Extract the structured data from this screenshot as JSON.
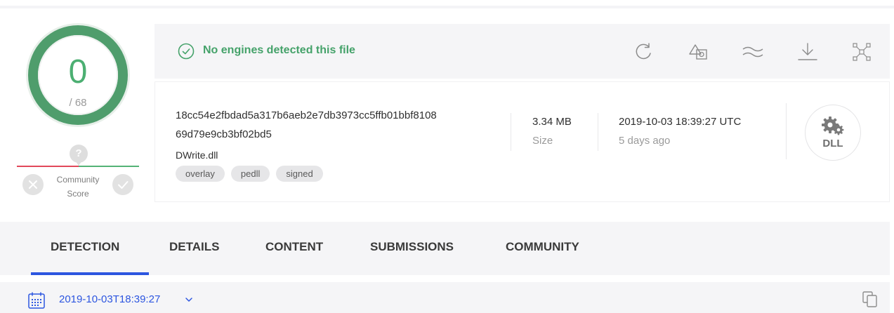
{
  "score": {
    "detections": "0",
    "total": "/ 68",
    "ring_color": "#4f9d6c"
  },
  "community": {
    "label_line1": "Community",
    "label_line2": "Score",
    "marker": "?",
    "down_icon": "close-icon",
    "up_icon": "check-icon"
  },
  "header": {
    "status_text": "No engines detected this file",
    "status_color": "#45a26a",
    "actions": [
      "reanalyze-icon",
      "similar-icon",
      "graph-icon",
      "download-icon",
      "fullscreen-icon"
    ]
  },
  "file": {
    "hash_line1": "18cc54e2fbdad5a317b6aeb2e7db3973cc5ffb01bbf8108",
    "hash_line2": "69d79e9cb3bf02bd5",
    "name": "DWrite.dll",
    "tags": [
      "overlay",
      "pedll",
      "signed"
    ],
    "size_value": "3.34 MB",
    "size_label": "Size",
    "date_value": "2019-10-03 18:39:27 UTC",
    "date_label": "5 days ago",
    "type_badge": "DLL"
  },
  "tabs": [
    {
      "label": "DETECTION",
      "active": true
    },
    {
      "label": "DETAILS"
    },
    {
      "label": "CONTENT"
    },
    {
      "label": "SUBMISSIONS"
    },
    {
      "label": "COMMUNITY"
    }
  ],
  "analysis": {
    "date": "2019-10-03T18:39:27",
    "accent": "#2d56e0"
  }
}
